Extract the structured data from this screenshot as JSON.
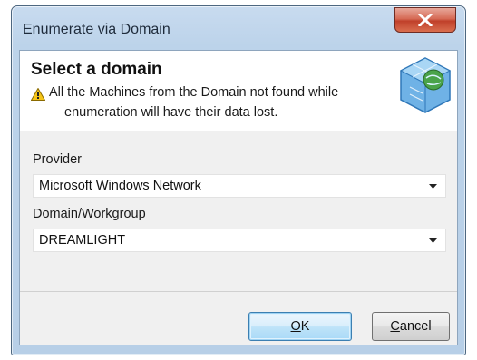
{
  "window": {
    "title": "Enumerate via Domain"
  },
  "header": {
    "title": "Select a domain",
    "warning_line1": "All the Machines from the Domain not found while",
    "warning_line2": "enumeration will have their data lost.",
    "warning_icon": "warning-triangle-icon",
    "graphic_icon": "globe-network-icon"
  },
  "provider": {
    "label": "Provider",
    "selected": "Microsoft Windows Network"
  },
  "domain": {
    "label": "Domain/Workgroup",
    "selected": "DREAMLIGHT"
  },
  "buttons": {
    "ok_accel": "O",
    "ok_rest": "K",
    "cancel_accel": "C",
    "cancel_rest": "ancel"
  },
  "colors": {
    "frame": "#bcd3ea",
    "close_button": "#c0402a",
    "default_button_border": "#3c7fb1"
  }
}
